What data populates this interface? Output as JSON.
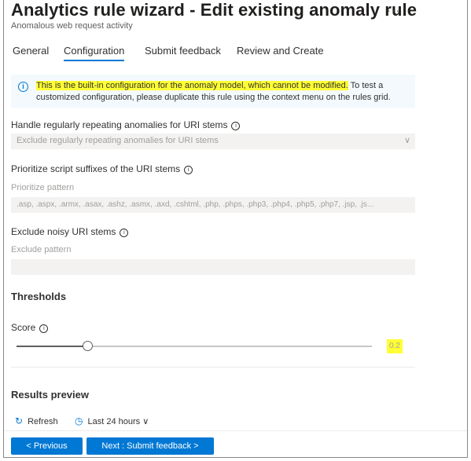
{
  "header": {
    "title": "Analytics rule wizard - Edit existing anomaly rule",
    "more_label": "···",
    "subtitle": "Anomalous web request activity"
  },
  "tabs": [
    {
      "label": "General",
      "active": false
    },
    {
      "label": "Configuration",
      "active": true
    },
    {
      "label": "Submit feedback",
      "active": false
    },
    {
      "label": "Review and Create",
      "active": false
    }
  ],
  "info": {
    "icon": "info-icon",
    "highlighted_text": "This is the built-in configuration for the anomaly model, which cannot be modified.",
    "text_rest": " To test a",
    "text_line2": "customized configuration, please duplicate this rule using the context menu on the rules grid.",
    "highlight_color": "#ffff33"
  },
  "form": {
    "repeating_label": "Handle regularly repeating anomalies for URI stems",
    "repeating_value": "Exclude regularly repeating anomalies for URI stems",
    "suffix_label": "Prioritize script suffixes of the URI stems",
    "suffix_sublabel": "Prioritize pattern",
    "suffix_value": ".asp, .aspx, .armx, .asax, .ashz, .asmx, .axd, .cshtml, .php, .phps, .php3, .php4, .php5, .php7, .jsp, .js...",
    "noisy_label": "Exclude noisy URI stems",
    "noisy_sublabel": "Exclude pattern",
    "noisy_value": "",
    "help_glyph": "i"
  },
  "thresholds": {
    "heading": "Thresholds",
    "score_label": "Score",
    "score_value": "0.2",
    "score_fraction": 0.2
  },
  "results": {
    "heading": "Results preview",
    "refresh_label": "Refresh",
    "range_label": "Last 24 hours"
  },
  "footer": {
    "previous_label": "< Previous",
    "next_label": "Next : Submit feedback >"
  },
  "colors": {
    "accent": "#0078d4",
    "highlight": "#ffff33",
    "disabled_text": "#a19f9d"
  }
}
